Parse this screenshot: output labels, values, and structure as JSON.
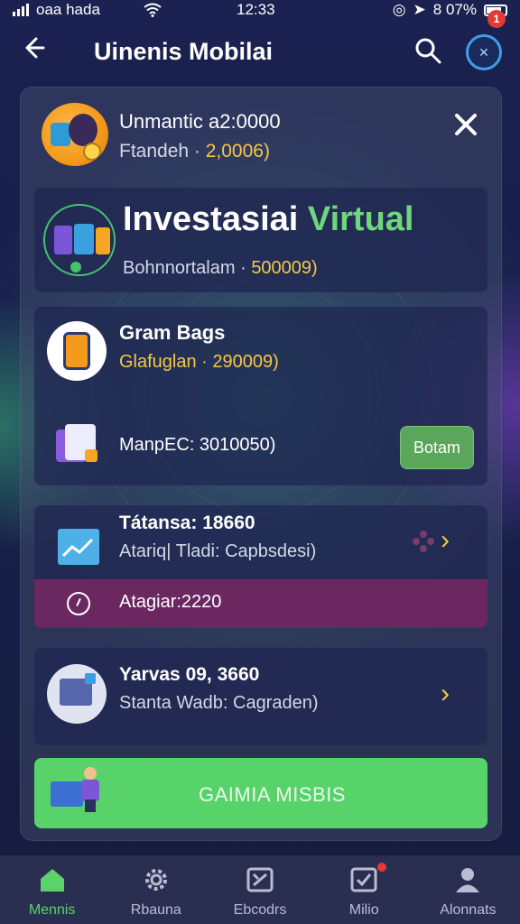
{
  "status_bar": {
    "carrier": "oaa hada",
    "time": "12:33",
    "battery": "8 07%"
  },
  "header": {
    "title": "Uinenis Mobilai",
    "profile_badge": "1"
  },
  "card": {
    "user_name": "Unmantic a2:0000",
    "user_sub_label": "Ftandeh ·",
    "user_sub_value": "2,0006)"
  },
  "invest": {
    "title_white": "Investasiai",
    "title_green": "Virtual",
    "sub_label": "Bohnnortalam ·",
    "sub_value": "500009)"
  },
  "game": {
    "title": "Gram Bags",
    "sub_label": "Glafuglan ·",
    "sub_value": "290009)",
    "map_text": "ManpEC: 3010050)",
    "action_label": "Botam"
  },
  "transaction": {
    "title": "Tátansa: 18660",
    "subtitle": "Atariq| Tladi: Capbsdesi)",
    "purple_text": "Atagiar:2220"
  },
  "yarn": {
    "title": "Yarvas 09, 3660",
    "subtitle": "Stanta Wadb: Cagraden)"
  },
  "cta": {
    "label": "GAIMIA MISBIS"
  },
  "nav": [
    {
      "label": "Mennis",
      "icon": "home-icon",
      "active": true
    },
    {
      "label": "Rbauna",
      "icon": "gear-icon",
      "active": false
    },
    {
      "label": "Ebcodrs",
      "icon": "tools-icon",
      "active": false
    },
    {
      "label": "Milio",
      "icon": "checklist-icon",
      "active": false
    },
    {
      "label": "Alonnats",
      "icon": "person-icon",
      "active": false
    }
  ],
  "colors": {
    "accent_green": "#58d36a",
    "gold": "#f7c744",
    "purple_row": "#6a2760",
    "nav_bg": "#2a2f52"
  }
}
